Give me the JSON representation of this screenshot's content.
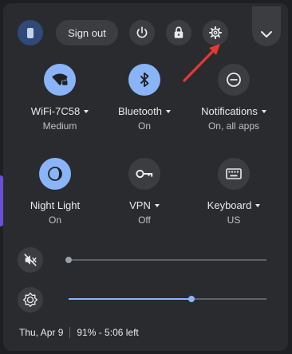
{
  "header": {
    "sign_out_label": "Sign out"
  },
  "tiles": [
    {
      "label": "WiFi-7C58",
      "sub": "Medium",
      "active": true,
      "icon": "wifi-lock-icon"
    },
    {
      "label": "Bluetooth",
      "sub": "On",
      "active": true,
      "icon": "bluetooth-icon"
    },
    {
      "label": "Notifications",
      "sub": "On, all apps",
      "active": false,
      "icon": "notifications-icon"
    },
    {
      "label": "Night Light",
      "sub": "On",
      "active": true,
      "icon": "night-light-icon"
    },
    {
      "label": "VPN",
      "sub": "Off",
      "active": false,
      "icon": "vpn-key-icon"
    },
    {
      "label": "Keyboard",
      "sub": "US",
      "active": false,
      "icon": "keyboard-icon"
    }
  ],
  "sliders": {
    "volume": {
      "level": 0.0,
      "muted": true
    },
    "brightness": {
      "level": 0.62
    }
  },
  "footer": {
    "date": "Thu, Apr 9",
    "battery": "91% - 5:06 left"
  },
  "colors": {
    "accent": "#8ab4f8",
    "panel": "#2a2b2e",
    "annotation": "#e53935"
  }
}
